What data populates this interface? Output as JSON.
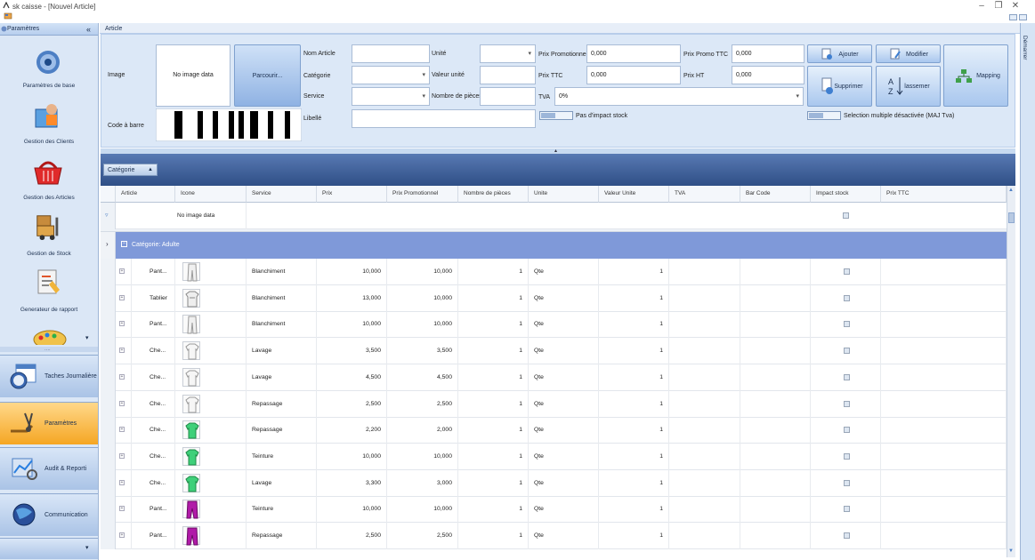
{
  "window": {
    "title": "sk caisse - [Nouvel Article]"
  },
  "sidebar": {
    "header": "Paramètres",
    "collapse_icon": "«",
    "items": [
      {
        "label": "Paramètres de base",
        "icon": "gear-icon"
      },
      {
        "label": "Gestion des Clients",
        "icon": "clients-icon"
      },
      {
        "label": "Gestion des Articles",
        "icon": "basket-icon"
      },
      {
        "label": "Gestion de Stock",
        "icon": "forklift-icon"
      },
      {
        "label": "Generateur de rapport",
        "icon": "report-icon"
      }
    ],
    "tabs": [
      {
        "label": "Taches Journalière",
        "icon": "calendar-clock-icon"
      },
      {
        "label": "Paramètres",
        "icon": "tools-icon",
        "active": true
      },
      {
        "label": "Audit & Reporti",
        "icon": "audit-icon"
      },
      {
        "label": "Communication",
        "icon": "globe-icon"
      }
    ]
  },
  "right_bar": {
    "label": "Démarrer"
  },
  "form": {
    "section_tab": "Article",
    "image_label": "Image",
    "no_image": "No image data",
    "browse_button": "Parcourir...",
    "barcode_label": "Code à barre",
    "nom_article_label": "Nom Article",
    "categorie_label": "Catégorie",
    "service_label": "Service",
    "libelle_label": "Libellé",
    "unite_label": "Unité",
    "valeur_unite_label": "Valeur unité",
    "nombre_pieces_label": "Nombre de pièces",
    "prix_promo_label": "Prix Promotionnel",
    "prix_promo_value": "0,000",
    "prix_ttc_label": "Prix TTC",
    "prix_ttc_value": "0,000",
    "tva_label": "TVA",
    "tva_value": "0%",
    "prix_promo_ttc_label": "Prix Promo TTC",
    "prix_promo_ttc_value": "0,000",
    "prix_ht_label": "Prix HT",
    "prix_ht_value": "0,000",
    "impact_toggle_label": "Pas d'impact stock",
    "selection_toggle_label": "Selection multiple désactivée (MAJ Tva)",
    "buttons": {
      "ajouter": "Ajouter",
      "modifier": "Modifier",
      "mapping": "Mapping",
      "supprimer": "Supprimer",
      "classer": "lassemer"
    }
  },
  "grid": {
    "group_chip": "Catégorie",
    "columns": [
      "Article",
      "Icone",
      "Service",
      "Prix",
      "Prix Promotionnel",
      "Nombre de pièces",
      "Unite",
      "Valeur Unite",
      "TVA",
      "Bar Code",
      "Impact stock",
      "Prix TTC"
    ],
    "filter_row_text": "No image data",
    "group_label": "Catégorie: Adulte",
    "rows": [
      {
        "article": "Pant...",
        "icon": "pants-white",
        "service": "Blanchiment",
        "prix": "10,000",
        "promo": "10,000",
        "pieces": "1",
        "unite": "Qte",
        "valeur": "1"
      },
      {
        "article": "Tablier",
        "icon": "apron-white",
        "service": "Blanchiment",
        "prix": "13,000",
        "promo": "10,000",
        "pieces": "1",
        "unite": "Qte",
        "valeur": "1"
      },
      {
        "article": "Pant...",
        "icon": "pants-white",
        "service": "Blanchiment",
        "prix": "10,000",
        "promo": "10,000",
        "pieces": "1",
        "unite": "Qte",
        "valeur": "1"
      },
      {
        "article": "Che...",
        "icon": "shirt-white",
        "service": "Lavage",
        "prix": "3,500",
        "promo": "3,500",
        "pieces": "1",
        "unite": "Qte",
        "valeur": "1"
      },
      {
        "article": "Che...",
        "icon": "shirt-white",
        "service": "Lavage",
        "prix": "4,500",
        "promo": "4,500",
        "pieces": "1",
        "unite": "Qte",
        "valeur": "1"
      },
      {
        "article": "Che...",
        "icon": "shirt-white",
        "service": "Repassage",
        "prix": "2,500",
        "promo": "2,500",
        "pieces": "1",
        "unite": "Qte",
        "valeur": "1"
      },
      {
        "article": "Che...",
        "icon": "shirt-green",
        "service": "Repassage",
        "prix": "2,200",
        "promo": "2,000",
        "pieces": "1",
        "unite": "Qte",
        "valeur": "1"
      },
      {
        "article": "Che...",
        "icon": "shirt-green",
        "service": "Teinture",
        "prix": "10,000",
        "promo": "10,000",
        "pieces": "1",
        "unite": "Qte",
        "valeur": "1"
      },
      {
        "article": "Che...",
        "icon": "shirt-green",
        "service": "Lavage",
        "prix": "3,300",
        "promo": "3,000",
        "pieces": "1",
        "unite": "Qte",
        "valeur": "1"
      },
      {
        "article": "Pant...",
        "icon": "pants-purple",
        "service": "Teinture",
        "prix": "10,000",
        "promo": "10,000",
        "pieces": "1",
        "unite": "Qte",
        "valeur": "1"
      },
      {
        "article": "Pant...",
        "icon": "pants-purple",
        "service": "Repassage",
        "prix": "2,500",
        "promo": "2,500",
        "pieces": "1",
        "unite": "Qte",
        "valeur": "1"
      }
    ]
  },
  "colors": {
    "accent": "#f5a623",
    "header_band": "#2f4f86",
    "group_row": "#7f99d9"
  }
}
